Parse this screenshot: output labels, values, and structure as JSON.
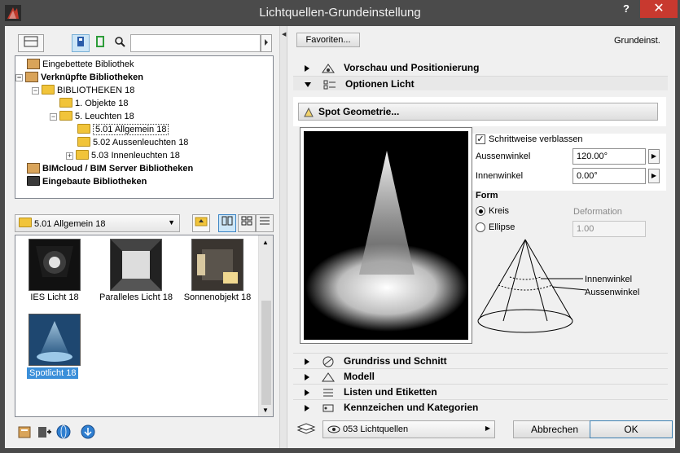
{
  "window": {
    "title": "Lichtquellen-Grundeinstellung",
    "help": "?",
    "close": "✕"
  },
  "left": {
    "tree": [
      {
        "label": "Eingebettete Bibliothek",
        "bold": false
      },
      {
        "label": "Verknüpfte Bibliotheken",
        "bold": true
      },
      {
        "label": "BIBLIOTHEKEN 18",
        "bold": false
      },
      {
        "label": "1. Objekte 18",
        "bold": false
      },
      {
        "label": "5. Leuchten 18",
        "bold": false
      },
      {
        "label": "5.01 Allgemein 18",
        "bold": false
      },
      {
        "label": "5.02 Aussenleuchten 18",
        "bold": false
      },
      {
        "label": "5.03 Innenleuchten 18",
        "bold": false
      },
      {
        "label": "BIMcloud / BIM Server Bibliotheken",
        "bold": true
      },
      {
        "label": "Eingebaute Bibliotheken",
        "bold": true
      }
    ],
    "folder_dropdown": "5.01 Allgemein 18",
    "thumbnails": [
      {
        "label": "IES Licht 18"
      },
      {
        "label": "Paralleles Licht 18"
      },
      {
        "label": "Sonnenobjekt 18"
      },
      {
        "label": "Spotlicht 18"
      }
    ]
  },
  "right": {
    "favorites_button": "Favoriten...",
    "grundeinst_label": "Grundeinst.",
    "sections_top": [
      {
        "label": "Vorschau und Positionierung",
        "expanded": false
      },
      {
        "label": "Optionen Licht",
        "expanded": true
      }
    ],
    "spot_button": "Spot Geometrie...",
    "fade_checkbox": {
      "label": "Schrittweise verblassen",
      "checked": true
    },
    "outer_angle": {
      "label": "Aussenwinkel",
      "value": "120.00°"
    },
    "inner_angle": {
      "label": "Innenwinkel",
      "value": "0.00°"
    },
    "form_label": "Form",
    "radio_circle": "Kreis",
    "radio_ellipse": "Ellipse",
    "deformation_label": "Deformation",
    "deformation_value": "1.00",
    "diagram_inner": "Innenwinkel",
    "diagram_outer": "Aussenwinkel",
    "sections_bottom": [
      {
        "label": "Grundriss und Schnitt"
      },
      {
        "label": "Modell"
      },
      {
        "label": "Listen und Etiketten"
      },
      {
        "label": "Kennzeichen und Kategorien"
      }
    ],
    "layer_dropdown": "053 Lichtquellen",
    "cancel_button": "Abbrechen",
    "ok_button": "OK"
  }
}
